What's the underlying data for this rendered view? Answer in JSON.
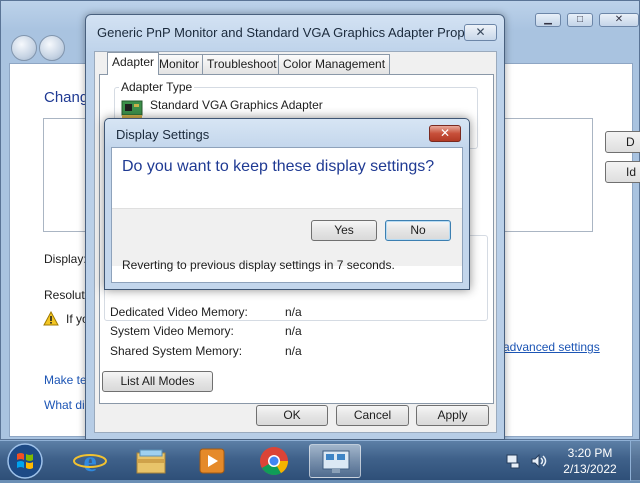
{
  "background_window": {
    "heading": "Chang",
    "display_label": "Display:",
    "resolution_label": "Resolutio",
    "warning_text": "If yo",
    "link_make": "Make te",
    "link_what": "What di",
    "advanced_link": "advanced settings",
    "detect_label": "D",
    "identify_label": "Id"
  },
  "properties": {
    "title": "Generic PnP Monitor and Standard VGA Graphics Adapter Properties",
    "close_glyph": "✕",
    "tabs": [
      "Adapter",
      "Monitor",
      "Troubleshoot",
      "Color Management"
    ],
    "adapter_type_label": "Adapter Type",
    "adapter_name": "Standard VGA Graphics Adapter",
    "memory": [
      {
        "label": "Dedicated Video Memory:",
        "value": "n/a"
      },
      {
        "label": "System Video Memory:",
        "value": "n/a"
      },
      {
        "label": "Shared System Memory:",
        "value": "n/a"
      }
    ],
    "list_modes_label": "List All Modes",
    "ok_label": "OK",
    "cancel_label": "Cancel",
    "apply_label": "Apply"
  },
  "dialog": {
    "title": "Display Settings",
    "close_glyph": "✕",
    "question": "Do you want to keep these display settings?",
    "yes_label": "Yes",
    "no_label": "No",
    "revert_text": "Reverting to previous display settings in 7 seconds."
  },
  "taskbar": {
    "time": "3:20 PM",
    "date": "2/13/2022"
  }
}
